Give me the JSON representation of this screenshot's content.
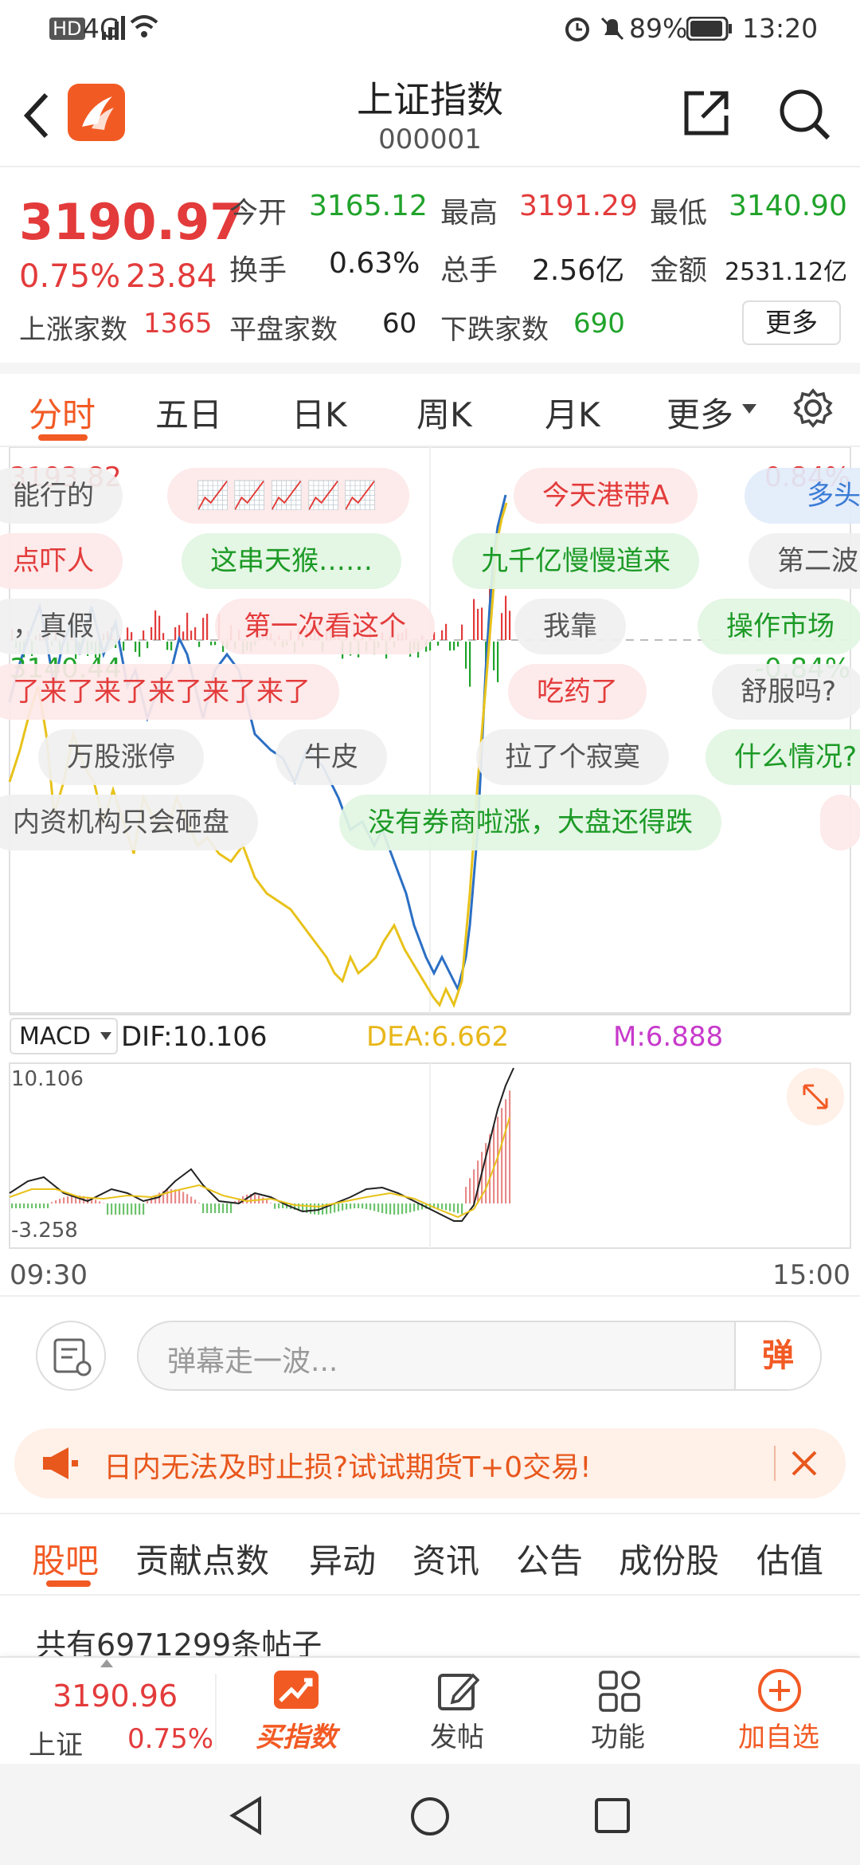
{
  "status_bar": {
    "signal": "4G",
    "battery": "89%",
    "time": "13:20"
  },
  "header": {
    "title": "上证指数",
    "code": "000001"
  },
  "quote": {
    "price": "3190.97",
    "change_pct": "0.75%",
    "change": "23.84",
    "open_label": "今开",
    "open": "3165.12",
    "high_label": "最高",
    "high": "3191.29",
    "low_label": "最低",
    "low": "3140.90",
    "turnover_label": "换手",
    "turnover": "0.63%",
    "volume_label": "总手",
    "volume": "2.56亿",
    "amount_label": "金额",
    "amount": "2531.12亿",
    "up_label": "上涨家数",
    "up": "1365",
    "flat_label": "平盘家数",
    "flat": "60",
    "down_label": "下跌家数",
    "down": "690",
    "more": "更多"
  },
  "tabs": [
    "分时",
    "五日",
    "日K",
    "周K",
    "月K",
    "更多"
  ],
  "chart": {
    "price_high": "3193.82",
    "price_low": "3140.44",
    "pct_high": "0.84%",
    "pct_low": "-0.84%",
    "macd_select": "MACD",
    "dif": "DIF:10.106",
    "dea": "DEA:6.662",
    "m": "M:6.888",
    "macd_max": "10.106",
    "macd_min": "-3.258",
    "time_start": "09:30",
    "time_end": "15:00"
  },
  "danmu": [
    "能行的",
    "今天港带A",
    "多头",
    "点吓人",
    "这串天猴……",
    "九千亿慢慢道来",
    "第二波",
    "，真假",
    "第一次看这个",
    "我靠",
    "操作市场",
    "了来了来了来了来了来了",
    "吃药了",
    "舒服吗?",
    "万股涨停",
    "牛皮",
    "拉了个寂寞",
    "什么情况?",
    "内资机构只会砸盘",
    "没有券商啦涨，大盘还得跌"
  ],
  "comment": {
    "placeholder": "弹幕走一波...",
    "send": "弹"
  },
  "ad": {
    "text": "日内无法及时止损?试试期货T+0交易!"
  },
  "subtabs": [
    "股吧",
    "贡献点数",
    "异动",
    "资讯",
    "公告",
    "成份股",
    "估值"
  ],
  "posts_count": "共有6971299条帖子",
  "bottom_nav": {
    "index_price": "3190.96",
    "index_name": "上证",
    "index_change": "0.75%",
    "buy": "买指数",
    "post": "发帖",
    "function": "功能",
    "add": "加自选"
  },
  "colors": {
    "accent": "#f25a24",
    "up": "#e33b3b",
    "down": "#21a32b"
  }
}
